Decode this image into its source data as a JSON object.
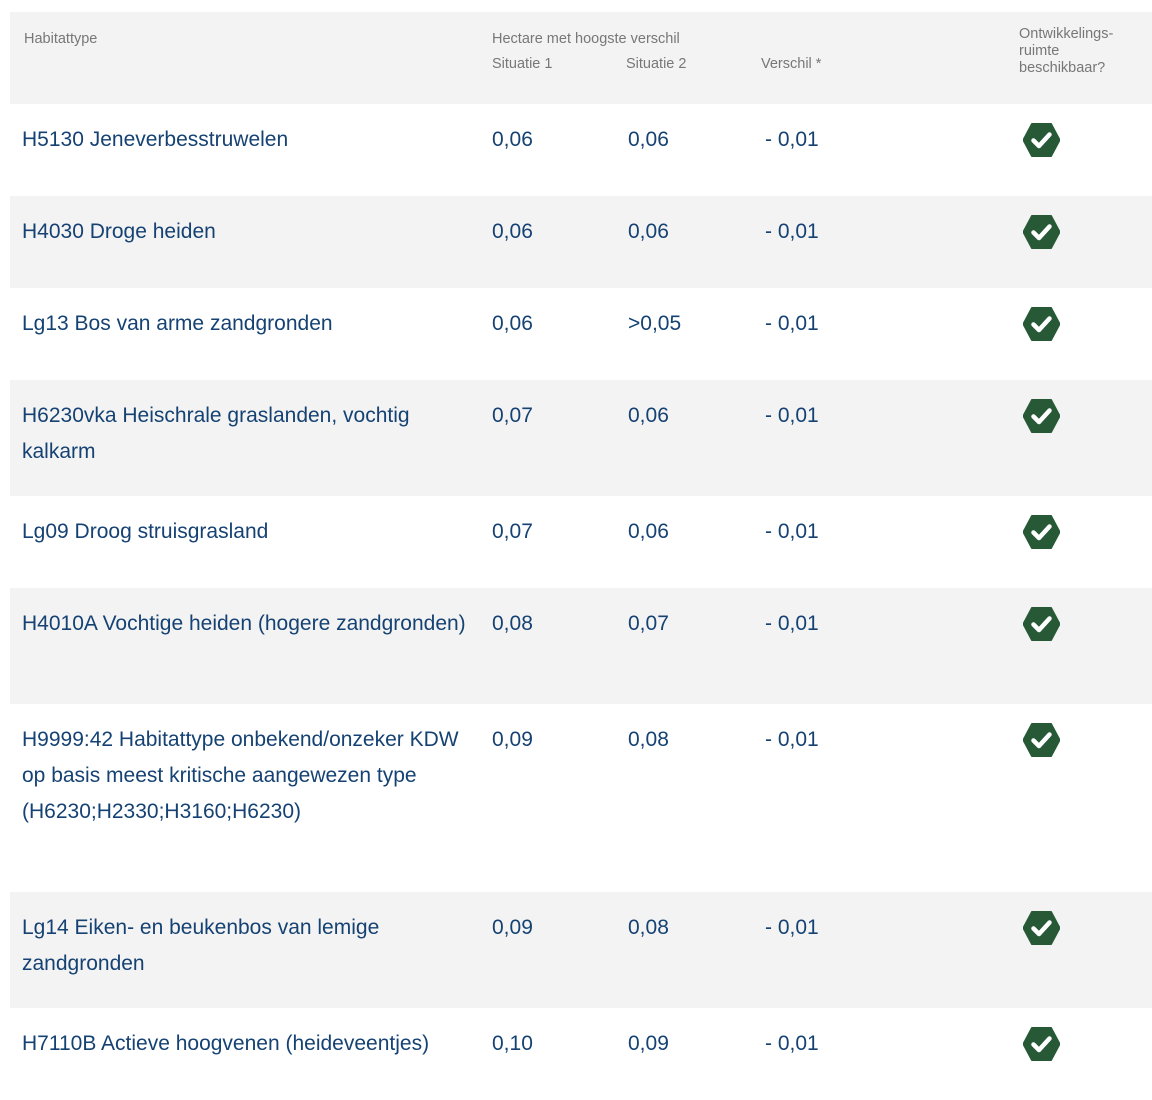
{
  "header": {
    "habitat_label": "Habitattype",
    "hectare_label": "Hectare met hoogste verschil",
    "situation1_label": "Situatie 1",
    "situation2_label": "Situatie 2",
    "difference_label": "Verschil *",
    "availability_label": "Ontwikkelings-\nruimte\nbeschikbaar?"
  },
  "colors": {
    "link_text": "#154273",
    "header_text": "#777777",
    "row_alt_bg": "#f3f3f3",
    "check_fill": "#275937"
  },
  "status_icon": "check-hexagon-icon",
  "rows": [
    {
      "name": "H5130 Jeneverbesstruwelen",
      "situation1": "0,06",
      "situation2": "0,06",
      "difference": "- 0,01",
      "available": true
    },
    {
      "name": "H4030 Droge heiden",
      "situation1": "0,06",
      "situation2": "0,06",
      "difference": "- 0,01",
      "available": true
    },
    {
      "name": "Lg13 Bos van arme zandgronden",
      "situation1": "0,06",
      "situation2": ">0,05",
      "difference": "- 0,01",
      "available": true
    },
    {
      "name": "H6230vka Heischrale graslanden, vochtig kalkarm",
      "situation1": "0,07",
      "situation2": "0,06",
      "difference": "- 0,01",
      "available": true
    },
    {
      "name": "Lg09 Droog struisgrasland",
      "situation1": "0,07",
      "situation2": "0,06",
      "difference": "- 0,01",
      "available": true
    },
    {
      "name": "H4010A Vochtige heiden (hogere zandgronden)",
      "situation1": "0,08",
      "situation2": "0,07",
      "difference": "- 0,01",
      "available": true
    },
    {
      "name": "H9999:42 Habitattype onbekend/onzeker KDW op basis meest kritische aangewezen type (H6230;H2330;H3160;H6230)",
      "situation1": "0,09",
      "situation2": "0,08",
      "difference": "- 0,01",
      "available": true
    },
    {
      "name": "Lg14 Eiken- en beukenbos van lemige zandgronden",
      "situation1": "0,09",
      "situation2": "0,08",
      "difference": "- 0,01",
      "available": true
    },
    {
      "name": "H7110B Actieve hoogvenen (heideveentjes)",
      "situation1": "0,10",
      "situation2": "0,09",
      "difference": "- 0,01",
      "available": true
    }
  ]
}
